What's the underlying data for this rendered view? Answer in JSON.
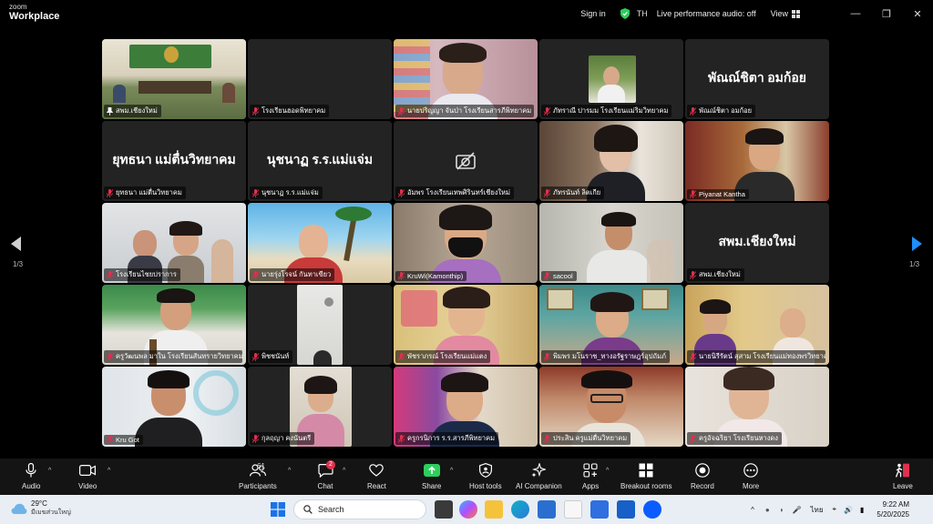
{
  "window": {
    "brand_small": "zoom",
    "brand_big": "Workplace",
    "signin": "Sign in",
    "language": "TH",
    "performance": "Live performance audio: off",
    "view": "View"
  },
  "gallery": {
    "page": "1/3",
    "tiles": [
      {
        "name": "สพม.เชียงใหม่",
        "big": "",
        "muted": false,
        "active": true
      },
      {
        "name": "โรงเรียนฮอดพิทยาคม",
        "big": "",
        "muted": true
      },
      {
        "name": "นายปริญญา จันป่า โรงเรียนสารภีพิทยาคม",
        "big": "",
        "muted": true
      },
      {
        "name": "ภัทราณี ปารมม โรงเรียนแม่ริมวิทยาคม",
        "big": "",
        "muted": true
      },
      {
        "name": "พัณณ์ชิตา อมก้อย",
        "big": "พัณณ์ชิตา อมก้อย",
        "muted": true
      },
      {
        "name": "ยุทธนา แม่ตื่นวิทยาคม",
        "big": "ยุทธนา แม่ตื่นวิทยาคม",
        "muted": true
      },
      {
        "name": "นุชนาฏ ร.ร.แม่แจ่ม",
        "big": "นุชนาฏ ร.ร.แม่แจ่ม",
        "muted": true
      },
      {
        "name": "อัมพร โรงเรียนเทพศิรินทร์เชียงใหม่",
        "big": "",
        "muted": true,
        "camera_off": true
      },
      {
        "name": "ภัทรนันท์ ลิตเกีย",
        "big": "",
        "muted": true
      },
      {
        "name": "Piyanat Kantha",
        "big": "",
        "muted": true
      },
      {
        "name": "โรงเรียนไชยปราการ",
        "big": "",
        "muted": true
      },
      {
        "name": "นายรุ่งโรจน์ กันทาเขียว",
        "big": "",
        "muted": true
      },
      {
        "name": "KruWi(Kamonthip)",
        "big": "",
        "muted": true
      },
      {
        "name": "sacool",
        "big": "",
        "muted": true
      },
      {
        "name": "สพม.เชียงใหม่",
        "big": "สพม.เชียงใหม่",
        "muted": true
      },
      {
        "name": "ครูวัฒนพล มาใน โรงเรียนสันทรายวิทยาคม",
        "big": "",
        "muted": true
      },
      {
        "name": "พิชชนันท์",
        "big": "",
        "muted": true
      },
      {
        "name": "พัชราภรณ์ โรงเรียนแม่แตง",
        "big": "",
        "muted": true
      },
      {
        "name": "พิมพร มโนราช_ทางอรัฐราษฎร์อุปถัมภ์",
        "big": "",
        "muted": true
      },
      {
        "name": "นายนิรีรัตน์ สุสาม โรงเรียนแม่ทองพรวิทยาคม",
        "big": "",
        "muted": true
      },
      {
        "name": "Kru Got",
        "big": "",
        "muted": true
      },
      {
        "name": "กุลฤญา คงนันตรี",
        "big": "",
        "muted": true
      },
      {
        "name": "ครูกรนิการ ร.ร.สารภีพิทยาคม",
        "big": "",
        "muted": true
      },
      {
        "name": "ประสิน ครูแม่ตื่นวิทยาคม",
        "big": "",
        "muted": true
      },
      {
        "name": "ครูอัจฉริยา โรงเรียนหางดง",
        "big": "",
        "muted": true
      }
    ]
  },
  "toolbar": {
    "audio": "Audio",
    "video": "Video",
    "participants": "Participants",
    "participants_count": "61",
    "chat": "Chat",
    "chat_badge": "2",
    "react": "React",
    "share": "Share",
    "host_tools": "Host tools",
    "ai_companion": "AI Companion",
    "apps": "Apps",
    "breakout": "Breakout rooms",
    "record": "Record",
    "more": "More",
    "leave": "Leave"
  },
  "taskbar": {
    "temp": "29°C",
    "weather_desc": "มีเมฆส่วนใหญ่",
    "search": "Search",
    "lang": "ไทย",
    "time": "9:22 AM",
    "date": "5/20/2025"
  },
  "colors": {
    "accent_green": "#2dce5c",
    "tile_bg": "#232323",
    "toolbar_bg": "#141414",
    "taskbar_bg": "#e9eef5",
    "leave_red": "#e0304e",
    "nav_blue": "#1e8fff"
  }
}
